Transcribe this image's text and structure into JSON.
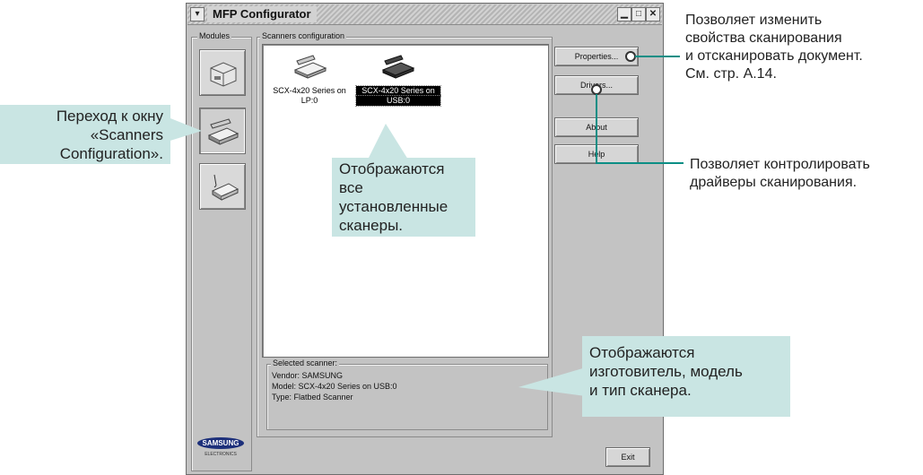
{
  "window": {
    "title": "MFP Configurator",
    "buttons": {
      "minimize": "▁",
      "maximize": "□",
      "close": "✕"
    }
  },
  "modules": {
    "label": "Modules",
    "items": [
      {
        "name": "printer",
        "icon": "printer-icon"
      },
      {
        "name": "scanner",
        "icon": "scanner-icon",
        "selected": true
      },
      {
        "name": "port",
        "icon": "port-icon"
      }
    ]
  },
  "scanners": {
    "group_label": "Scanners configuration",
    "items": [
      {
        "label_line1": "SCX-4x20 Series on",
        "label_line2": "LP:0",
        "selected": false
      },
      {
        "label_line1": "SCX-4x20 Series on",
        "label_line2": "USB:0",
        "selected": true
      }
    ]
  },
  "buttons": {
    "properties": "Properties...",
    "drivers": "Drivers...",
    "about": "About",
    "help": "Help",
    "exit": "Exit"
  },
  "selected_scanner": {
    "label": "Selected scanner:",
    "vendor": "Vendor: SAMSUNG",
    "model": "Model: SCX-4x20 Series on USB:0",
    "type": "Type: Flatbed Scanner"
  },
  "logo": {
    "brand": "SAMSUNG",
    "sub": "ELECTRONICS"
  },
  "callouts": {
    "scanners_config": [
      "Переход к окну",
      "«Scanners",
      "Configuration»."
    ],
    "all_scanners": [
      "Отображаются все",
      "установленные",
      "сканеры."
    ],
    "info": [
      "Отображаются",
      "изготовитель, модель",
      "и тип сканера."
    ]
  },
  "annotations": {
    "properties": [
      "Позволяет изменить",
      "свойства сканирования",
      "и отсканировать документ.",
      "См. стр. A.14."
    ],
    "drivers": [
      "Позволяет контролировать",
      "драйверы сканирования."
    ]
  },
  "colors": {
    "callout_bg": "#c9e5e3",
    "window_bg": "#c3c3c3",
    "selection": "#000000"
  }
}
